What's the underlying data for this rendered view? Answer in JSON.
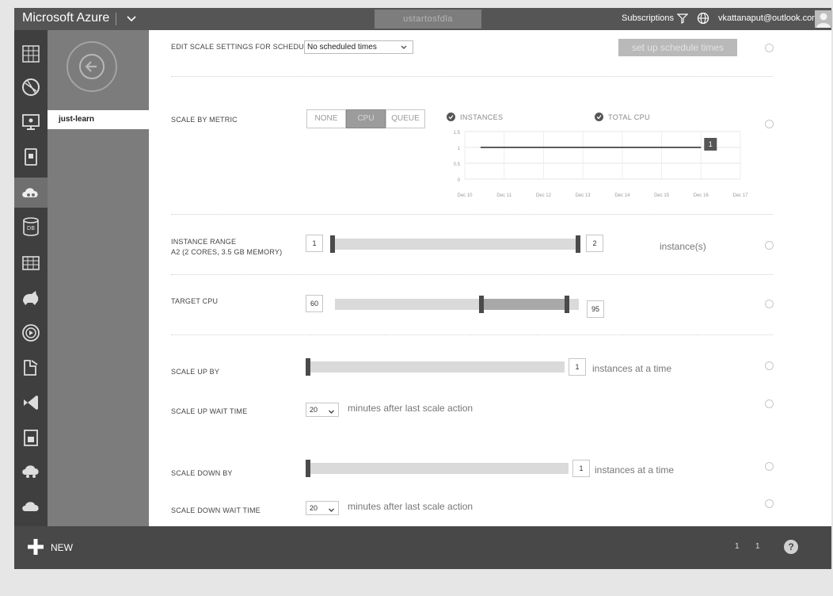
{
  "topbar": {
    "brand": "Microsoft Azure",
    "center_label": "ustartosfdla",
    "subscriptions": "Subscriptions",
    "email": "vkattanaput@outlook.com"
  },
  "subnav": {
    "item": "just-learn"
  },
  "schedule": {
    "label": "EDIT SCALE SETTINGS FOR SCHEDULE",
    "selected": "No scheduled times",
    "button": "set up schedule times"
  },
  "metric": {
    "label": "SCALE BY METRIC",
    "options": [
      "NONE",
      "CPU",
      "QUEUE"
    ],
    "selected": "CPU"
  },
  "chart_data": {
    "type": "line",
    "legend": [
      "INSTANCES",
      "TOTAL CPU"
    ],
    "x": [
      "Dec 10",
      "Dec 11",
      "Dec 12",
      "Dec 13",
      "Dec 14",
      "Dec 15",
      "Dec 16",
      "Dec 17"
    ],
    "yticks": [
      "1.5",
      "1",
      "0.5",
      "0"
    ],
    "ylim": [
      0,
      1.5
    ],
    "series": [
      {
        "name": "INSTANCES",
        "points": [
          [
            0.4,
            1
          ],
          [
            1,
            1
          ],
          [
            2,
            1
          ],
          [
            3,
            1
          ],
          [
            4,
            1
          ],
          [
            5,
            1
          ],
          [
            6,
            1
          ]
        ]
      }
    ],
    "end_label": "1",
    "grid": true
  },
  "instance_range": {
    "label": "INSTANCE RANGE",
    "sublabel": "A2 (2 CORES, 3.5 GB MEMORY)",
    "min": "1",
    "max": "2",
    "suffix": "instance(s)"
  },
  "target_cpu": {
    "label": "TARGET CPU",
    "min": "60",
    "max": "95",
    "range_pct": [
      60,
      95
    ]
  },
  "scale_up": {
    "label": "SCALE UP BY",
    "value": "1",
    "suffix": "instances at a time",
    "wait_label": "SCALE UP WAIT TIME",
    "wait_value": "20",
    "wait_suffix": "minutes after last scale action"
  },
  "scale_down": {
    "label": "SCALE DOWN BY",
    "value": "1",
    "suffix": "instances at a time",
    "wait_label": "SCALE DOWN WAIT TIME",
    "wait_value": "20",
    "wait_suffix": "minutes after last scale action"
  },
  "bottombar": {
    "new_label": "NEW",
    "count1": "1",
    "count2": "1"
  },
  "icons": [
    "grid-icon",
    "globe-icon",
    "monitor-icon",
    "mobile-icon",
    "cloud-services-icon",
    "db-icon",
    "table-icon",
    "hdinsight-icon",
    "media-icon",
    "automation-icon",
    "visual-studio-icon",
    "storage-icon",
    "network-icon",
    "cloud-icon"
  ]
}
